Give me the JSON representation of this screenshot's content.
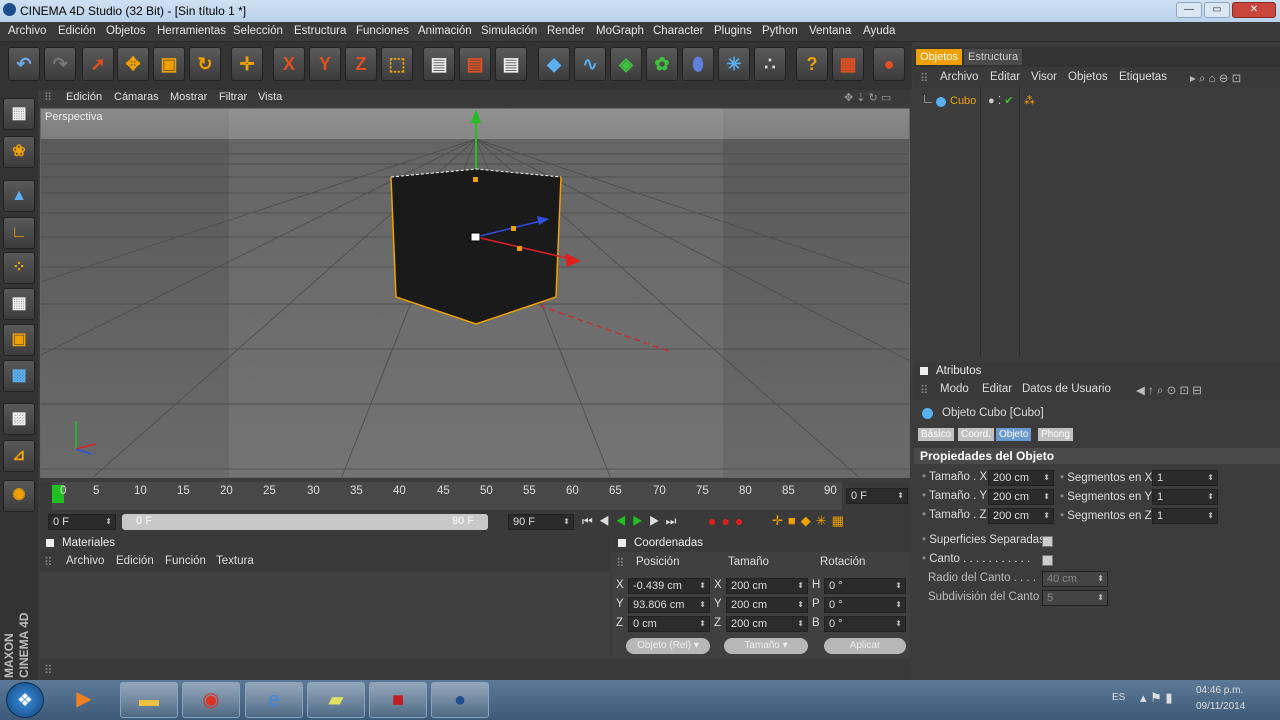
{
  "window": {
    "title": "CINEMA 4D Studio (32 Bit) - [Sin título 1 *]"
  },
  "menu": [
    "Archivo",
    "Edición",
    "Objetos",
    "Herramientas",
    "Selección",
    "Estructura",
    "Funciones",
    "Animación",
    "Simulación",
    "Render",
    "MoGraph",
    "Character",
    "Plugins",
    "Python",
    "Ventana",
    "Ayuda"
  ],
  "toolbar": {
    "x_label": "X",
    "y_label": "Y",
    "z_label": "Z"
  },
  "viewport": {
    "menu": [
      "Edición",
      "Cámaras",
      "Mostrar",
      "Filtrar",
      "Vista"
    ],
    "label": "Perspectiva"
  },
  "timeline": {
    "ticks": [
      "0",
      "5",
      "10",
      "15",
      "20",
      "25",
      "30",
      "35",
      "40",
      "45",
      "50",
      "55",
      "60",
      "65",
      "70",
      "75",
      "80",
      "85",
      "90"
    ],
    "current_frame": "0 F"
  },
  "transport": {
    "start": "0 F",
    "range_start": "0 F",
    "range_end": "90 F",
    "end": "90 F"
  },
  "materials": {
    "title": "Materiales",
    "menu": [
      "Archivo",
      "Edición",
      "Función",
      "Textura"
    ]
  },
  "coords": {
    "title": "Coordenadas",
    "headers": [
      "Posición",
      "Tamaño",
      "Rotación"
    ],
    "rows": [
      {
        "axis": "X",
        "pos": "-0.439 cm",
        "size_axis": "X",
        "size": "200 cm",
        "rot_axis": "H",
        "rot": "0 °"
      },
      {
        "axis": "Y",
        "pos": "93.806 cm",
        "size_axis": "Y",
        "size": "200 cm",
        "rot_axis": "P",
        "rot": "0 °"
      },
      {
        "axis": "Z",
        "pos": "0 cm",
        "size_axis": "Z",
        "size": "200 cm",
        "rot_axis": "B",
        "rot": "0 °"
      }
    ],
    "mode_label": "Objeto (Rel)",
    "size_mode_label": "Tamaño",
    "apply_label": "Aplicar"
  },
  "objects": {
    "tabs": [
      "Objetos",
      "Estructura"
    ],
    "menu": [
      "Archivo",
      "Editar",
      "Visor",
      "Objetos",
      "Etiquetas"
    ],
    "items": [
      {
        "name": "Cubo"
      }
    ]
  },
  "attributes": {
    "title": "Atributos",
    "menu": [
      "Modo",
      "Editar",
      "Datos de Usuario"
    ],
    "object_label": "Objeto Cubo [Cubo]",
    "tabs": [
      "Básico",
      "Coord.",
      "Objeto",
      "Phong"
    ],
    "active_tab": "Objeto",
    "section": "Propiedades del Objeto",
    "size_rows": [
      {
        "label": "Tamaño . X",
        "value": "200 cm",
        "seg_label": "Segmentos en X",
        "seg": "1"
      },
      {
        "label": "Tamaño . Y",
        "value": "200 cm",
        "seg_label": "Segmentos en Y",
        "seg": "1"
      },
      {
        "label": "Tamaño . Z",
        "value": "200 cm",
        "seg_label": "Segmentos en Z",
        "seg": "1"
      }
    ],
    "separate_surfaces": "Superficies Separadas",
    "fillet": "Canto . . . . . . . . . . .",
    "fillet_radius_label": "Radio del Canto  . . . .",
    "fillet_radius": "40 cm",
    "fillet_subdiv_label": "Subdivisión del Canto",
    "fillet_subdiv": "5"
  },
  "brand": "MAXON CINEMA 4D",
  "tray": {
    "lang": "ES",
    "time": "04:46 p.m.",
    "date": "09/11/2014"
  },
  "colors": {
    "accent": "#f0a000",
    "panel": "#3c3c3c"
  }
}
